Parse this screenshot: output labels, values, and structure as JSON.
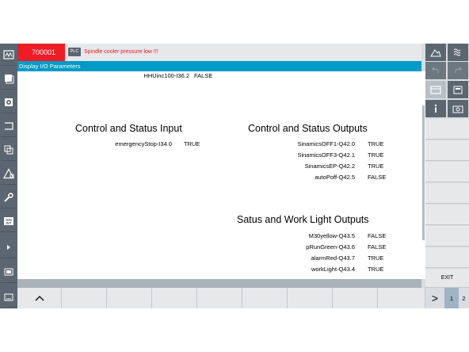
{
  "alarm": {
    "number": "700001",
    "badge": "PLC",
    "message": "Spindle cooler pressure low !!!"
  },
  "window": {
    "title": "Display I/O Parameters"
  },
  "top_row": {
    "label": "HHUinc100-I36.2",
    "value": "FALSE"
  },
  "control_input": {
    "heading": "Control and Status Input",
    "rows": [
      {
        "label": "emergencyStop-I34.0",
        "value": "TRUE"
      }
    ]
  },
  "control_output": {
    "heading": "Control and Status Outputs",
    "rows": [
      {
        "label": "SinamicsOFF1-Q42.0",
        "value": "TRUE"
      },
      {
        "label": "SinamicsOFF3-Q42.1",
        "value": "TRUE"
      },
      {
        "label": "SinamicsEP-Q42.2",
        "value": "TRUE"
      },
      {
        "label": "autoPoff-Q42.5",
        "value": "FALSE"
      }
    ]
  },
  "light_output": {
    "heading": "Satus and Work Light Outputs",
    "rows": [
      {
        "label": "M30yellow-Q43.5",
        "value": "FALSE"
      },
      {
        "label": "pRunGreen-Q43.6",
        "value": "FALSE"
      },
      {
        "label": "alarmRed-Q43.7",
        "value": "TRUE"
      },
      {
        "label": "workLight-Q43.4",
        "value": "TRUE"
      }
    ]
  },
  "softkeys": {
    "exit": "EXIT",
    "up_arrow": "^",
    "next_arrow": ">"
  },
  "pages": {
    "one": "1",
    "two": "2"
  },
  "icons": {
    "left": [
      "machine-icon",
      "program-icon",
      "offset-icon",
      "program-manager-icon",
      "diagnostics-icon",
      "alarm-icon",
      "setup-icon",
      "sinumerik-integrate-icon",
      "expand-icon",
      "screen-icon",
      "keyboard-icon"
    ],
    "right_top": [
      "mountain-icon",
      "wave-icon",
      "undo-icon",
      "redo-icon",
      "window-icon",
      "calculator-icon",
      "info-icon",
      "camera-icon"
    ]
  },
  "colors": {
    "alarm_red": "#ee1c25",
    "title_blue": "#009ac7",
    "toolbar_gray": "#5b6670"
  }
}
